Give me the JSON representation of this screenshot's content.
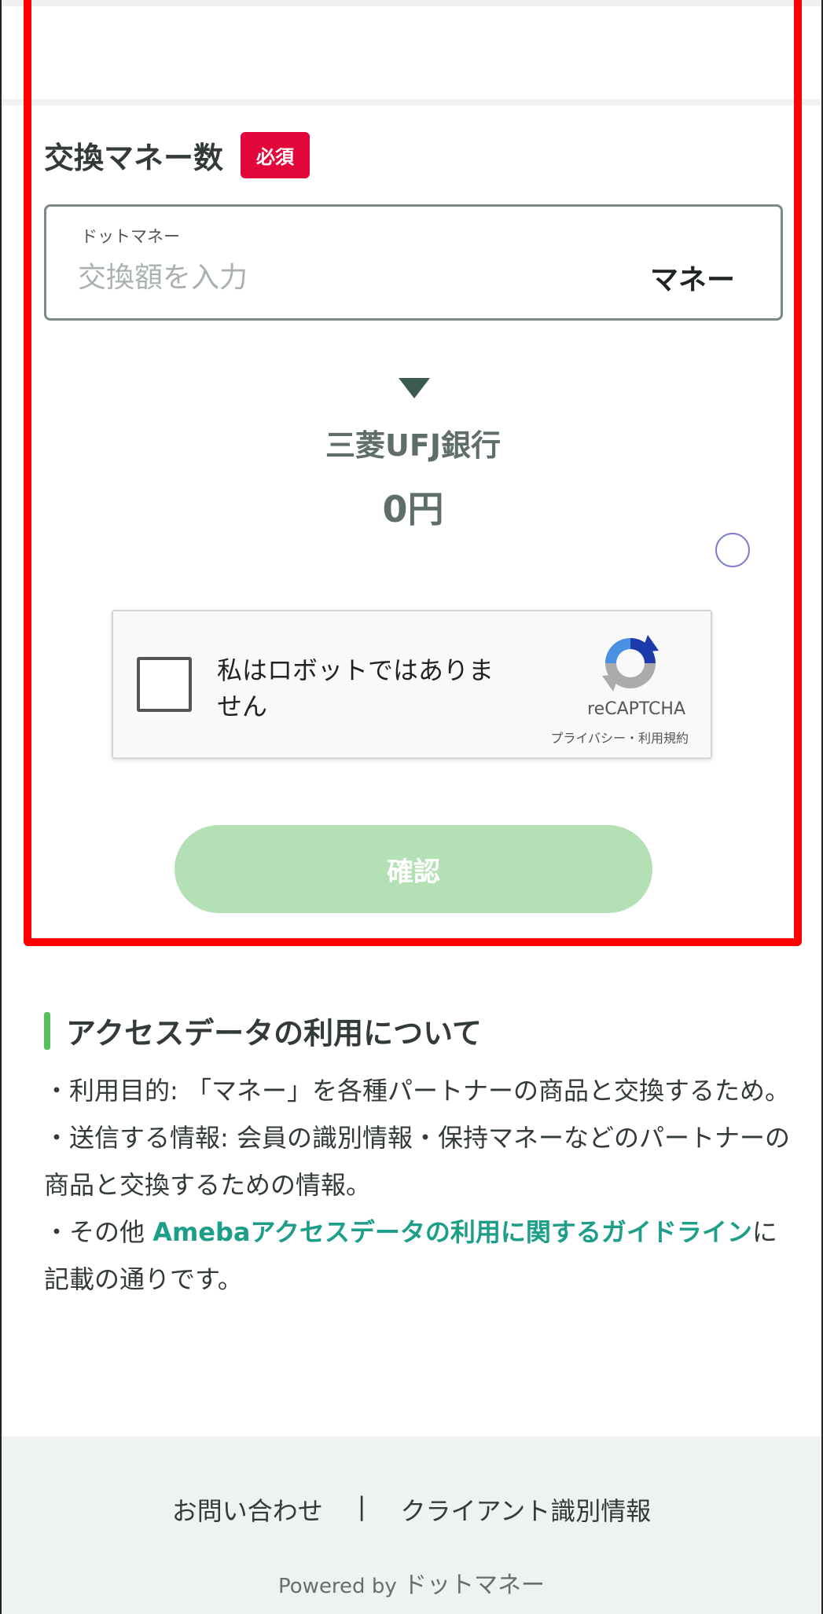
{
  "form": {
    "field_title": "交換マネー数",
    "required_badge": "必須",
    "input_caption": "ドットマネー",
    "input_placeholder": "交換額を入力",
    "input_unit": "マネー"
  },
  "result": {
    "bank_name": "三菱UFJ銀行",
    "amount": "0円"
  },
  "recaptcha": {
    "label": "私はロボットではありません",
    "brand": "reCAPTCHA",
    "terms": "プライバシー・利用規約"
  },
  "confirm_button": "確認",
  "access": {
    "title": "アクセスデータの利用について",
    "purpose": "・利用目的: 「マネー」を各種パートナーの商品と交換するため。",
    "info": "・送信する情報: 会員の識別情報・保持マネーなどのパートナーの商品と交換するための情報。",
    "other_prefix": "・その他 ",
    "other_link": "Amebaアクセスデータの利用に関するガイドライン",
    "other_suffix": "に記載の通りです。"
  },
  "footer": {
    "contact": "お問い合わせ",
    "separator": "|",
    "client_info": "クライアント識別情報",
    "powered_by": "Powered by",
    "powered_brand": "ドットマネー"
  },
  "colors": {
    "required": "#e2063a",
    "button_disabled": "#b3e0b4",
    "link": "#1c9e88",
    "section_accent": "#59c15c",
    "highlight": "#ff0000"
  }
}
